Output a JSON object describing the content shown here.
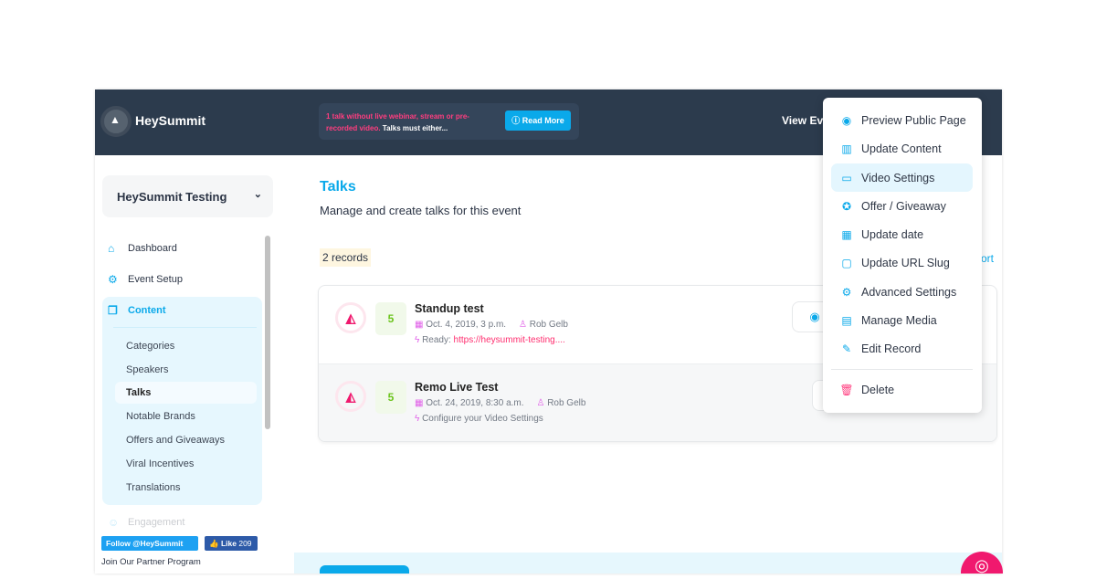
{
  "header": {
    "brand": "HeySummit",
    "notice_highlight": "1 talk without live webinar, stream or pre-recorded video.",
    "notice_rest": " Talks must either...",
    "read_more": "Read More",
    "view_event": "View Ev"
  },
  "sidebar": {
    "event_selector": "HeySummit Testing",
    "items": [
      {
        "label": "Dashboard",
        "icon": "home-icon"
      },
      {
        "label": "Event Setup",
        "icon": "gears-icon"
      },
      {
        "label": "Content",
        "icon": "copy-icon"
      }
    ],
    "content_sub": [
      "Categories",
      "Speakers",
      "Talks",
      "Notable Brands",
      "Offers and Giveaways",
      "Viral Incentives",
      "Translations"
    ],
    "engagement": "Engagement",
    "twitter": "Follow @HeySummit",
    "fb_like": "Like",
    "fb_count": "209",
    "partner": "Join Our Partner Program"
  },
  "main": {
    "title": "Talks",
    "subtitle": "Manage and create talks for this event",
    "records": "2 records",
    "export_partial": "ort",
    "talks": [
      {
        "title": "Standup test",
        "score": "5",
        "date": "Oct. 4, 2019, 3 p.m.",
        "speaker": "Rob Gelb",
        "status_label": "Ready: ",
        "status_link": "https://heysummit-testing...."
      },
      {
        "title": "Remo Live Test",
        "score": "5",
        "date": "Oct. 24, 2019, 8:30 a.m.",
        "speaker": "Rob Gelb",
        "status_label": "Configure your Video Settings",
        "status_link": ""
      }
    ]
  },
  "menu": {
    "items": [
      "Preview Public Page",
      "Update Content",
      "Video Settings",
      "Offer / Giveaway",
      "Update date",
      "Update URL Slug",
      "Advanced Settings",
      "Manage Media",
      "Edit Record"
    ],
    "delete": "Delete",
    "highlighted": "Video Settings"
  },
  "colors": {
    "accent": "#0aa9ea",
    "header": "#2c3b4d",
    "pink": "#f0196e"
  }
}
